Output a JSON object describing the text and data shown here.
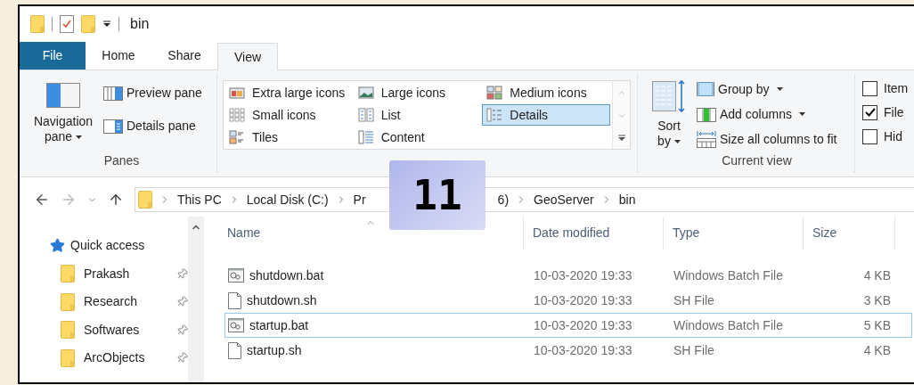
{
  "title_bar": {
    "title": "bin"
  },
  "tabs": [
    {
      "label": "File",
      "kind": "file",
      "selected": false
    },
    {
      "label": "Home",
      "kind": "tab",
      "selected": false
    },
    {
      "label": "Share",
      "kind": "tab",
      "selected": false
    },
    {
      "label": "View",
      "kind": "tab",
      "selected": true
    }
  ],
  "panes": {
    "label": "Panes",
    "navigation_pane": "Navigation pane",
    "preview_pane": "Preview pane",
    "details_pane": "Details pane"
  },
  "layout": {
    "options": [
      {
        "label": "Extra large icons",
        "kind": "xl",
        "selected": false
      },
      {
        "label": "Small icons",
        "kind": "small",
        "selected": false
      },
      {
        "label": "Tiles",
        "kind": "tiles",
        "selected": false
      },
      {
        "label": "Large icons",
        "kind": "large",
        "selected": false
      },
      {
        "label": "List",
        "kind": "list",
        "selected": false
      },
      {
        "label": "Content",
        "kind": "content",
        "selected": false
      },
      {
        "label": "Medium icons",
        "kind": "medium",
        "selected": false
      },
      {
        "label": "Details",
        "kind": "details",
        "selected": true
      }
    ]
  },
  "current_view": {
    "label": "Current view",
    "sort_by": "Sort by",
    "group_by": "Group by",
    "add_columns": "Add columns",
    "size_columns": "Size all columns to fit"
  },
  "show_hide": {
    "options": [
      {
        "label": "Item",
        "checked": false
      },
      {
        "label": "File",
        "checked": true
      },
      {
        "label": "Hid",
        "checked": false
      }
    ]
  },
  "address_bar": {
    "crumbs": [
      "This PC",
      "Local Disk (C:)",
      "Pr",
      "6)",
      "GeoServer",
      "bin"
    ]
  },
  "navigation": {
    "items": [
      {
        "label": "Quick access",
        "kind": "quick_access",
        "pinned": false
      },
      {
        "label": "Prakash",
        "kind": "folder",
        "pinned": true
      },
      {
        "label": "Research",
        "kind": "folder",
        "pinned": true
      },
      {
        "label": "Softwares",
        "kind": "folder",
        "pinned": true
      },
      {
        "label": "ArcObjects",
        "kind": "folder",
        "pinned": true
      }
    ]
  },
  "file_list": {
    "columns": [
      "Name",
      "Date modified",
      "Type",
      "Size"
    ],
    "rows": [
      {
        "name": "shutdown.bat",
        "date": "10-03-2020 19:33",
        "type": "Windows Batch File",
        "size": "4 KB",
        "kind": "batch",
        "focused": false
      },
      {
        "name": "shutdown.sh",
        "date": "10-03-2020 19:33",
        "type": "SH File",
        "size": "3 KB",
        "kind": "plain",
        "focused": false
      },
      {
        "name": "startup.bat",
        "date": "10-03-2020 19:33",
        "type": "Windows Batch File",
        "size": "5 KB",
        "kind": "batch",
        "focused": true
      },
      {
        "name": "startup.sh",
        "date": "10-03-2020 19:33",
        "type": "SH File",
        "size": "4 KB",
        "kind": "plain",
        "focused": false
      }
    ]
  },
  "badge": {
    "text": "11"
  }
}
